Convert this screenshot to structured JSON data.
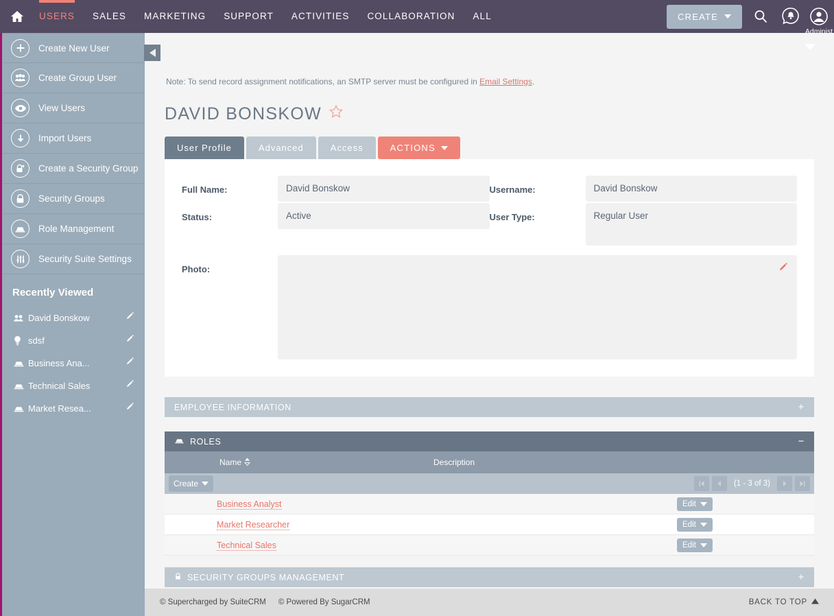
{
  "topnav": {
    "home_icon": "home-icon",
    "items": [
      {
        "label": "USERS",
        "active": true
      },
      {
        "label": "SALES",
        "active": false
      },
      {
        "label": "MARKETING",
        "active": false
      },
      {
        "label": "SUPPORT",
        "active": false
      },
      {
        "label": "ACTIVITIES",
        "active": false
      },
      {
        "label": "COLLABORATION",
        "active": false
      },
      {
        "label": "ALL",
        "active": false
      }
    ],
    "create_label": "CREATE",
    "search_icon": "search-icon",
    "notification_icon": "notification-bell-icon",
    "user_avatar_icon": "user-avatar-icon",
    "user_name": "Administ"
  },
  "sidebar": {
    "actions": [
      {
        "label": "Create New User",
        "icon": "plus-circle-icon"
      },
      {
        "label": "Create Group User",
        "icon": "group-users-icon"
      },
      {
        "label": "View Users",
        "icon": "eye-icon"
      },
      {
        "label": "Import Users",
        "icon": "download-arrow-icon"
      },
      {
        "label": "Create a Security Group",
        "icon": "lock-plus-icon"
      },
      {
        "label": "Security Groups",
        "icon": "lock-icon"
      },
      {
        "label": "Role Management",
        "icon": "roles-icon"
      },
      {
        "label": "Security Suite Settings",
        "icon": "sliders-icon"
      }
    ],
    "recently_viewed_title": "Recently Viewed",
    "recently_viewed": [
      {
        "label": "David Bonskow",
        "icon": "users-icon"
      },
      {
        "label": "sdsf",
        "icon": "lightbulb-icon"
      },
      {
        "label": "Business Ana...",
        "icon": "roles-icon"
      },
      {
        "label": "Technical Sales",
        "icon": "roles-icon"
      },
      {
        "label": "Market Resea...",
        "icon": "roles-icon"
      }
    ],
    "collapse_icon": "collapse-sidebar-icon"
  },
  "main": {
    "note_prefix": "Note: To send record assignment notifications, an SMTP server must be configured in ",
    "note_link": "Email Settings",
    "note_suffix": ".",
    "record_title": "DAVID BONSKOW",
    "favorite_icon": "star-outline-icon",
    "tabs": [
      {
        "label": "User Profile",
        "state": "active"
      },
      {
        "label": "Advanced",
        "state": "inactive"
      },
      {
        "label": "Access",
        "state": "inactive"
      }
    ],
    "actions_label": "ACTIONS",
    "fields": {
      "full_name_label": "Full Name:",
      "full_name_value": "David Bonskow",
      "status_label": "Status:",
      "status_value": "Active",
      "photo_label": "Photo:",
      "photo_value": "",
      "username_label": "Username:",
      "username_value": "David Bonskow",
      "user_type_label": "User Type:",
      "user_type_value": "Regular User",
      "photo_edit_icon": "pencil-edit-icon"
    },
    "panels": {
      "employee_information": {
        "title": "EMPLOYEE INFORMATION",
        "toggle": "+"
      },
      "roles": {
        "title": "ROLES",
        "toggle": "−",
        "icon": "roles-icon"
      },
      "security_groups": {
        "title": "SECURITY GROUPS MANAGEMENT",
        "toggle": "+",
        "icon": "lock-icon"
      }
    },
    "roles_table": {
      "columns": [
        "Name",
        "Description"
      ],
      "create_label": "Create",
      "pagination": {
        "first": "⏮",
        "prev": "‹",
        "count": "(1 - 3 of 3)",
        "next": "›",
        "last": "⏭"
      },
      "rows": [
        {
          "name": "Business Analyst",
          "description": "",
          "action": "Edit"
        },
        {
          "name": "Market Researcher",
          "description": "",
          "action": "Edit"
        },
        {
          "name": "Technical Sales",
          "description": "",
          "action": "Edit"
        }
      ]
    }
  },
  "footer": {
    "credit_suitecrm": "© Supercharged by SuiteCRM",
    "credit_sugarcrm": "© Powered By SugarCRM",
    "back_to_top": "BACK TO TOP"
  },
  "colors": {
    "nav_bg": "#534b62",
    "accent_coral": "#f08377",
    "sidebar_bg": "#9aabb9",
    "sidebar_stripe": "#a0136b",
    "panel_dark": "#677585",
    "panel_light": "#bdc8d1"
  }
}
